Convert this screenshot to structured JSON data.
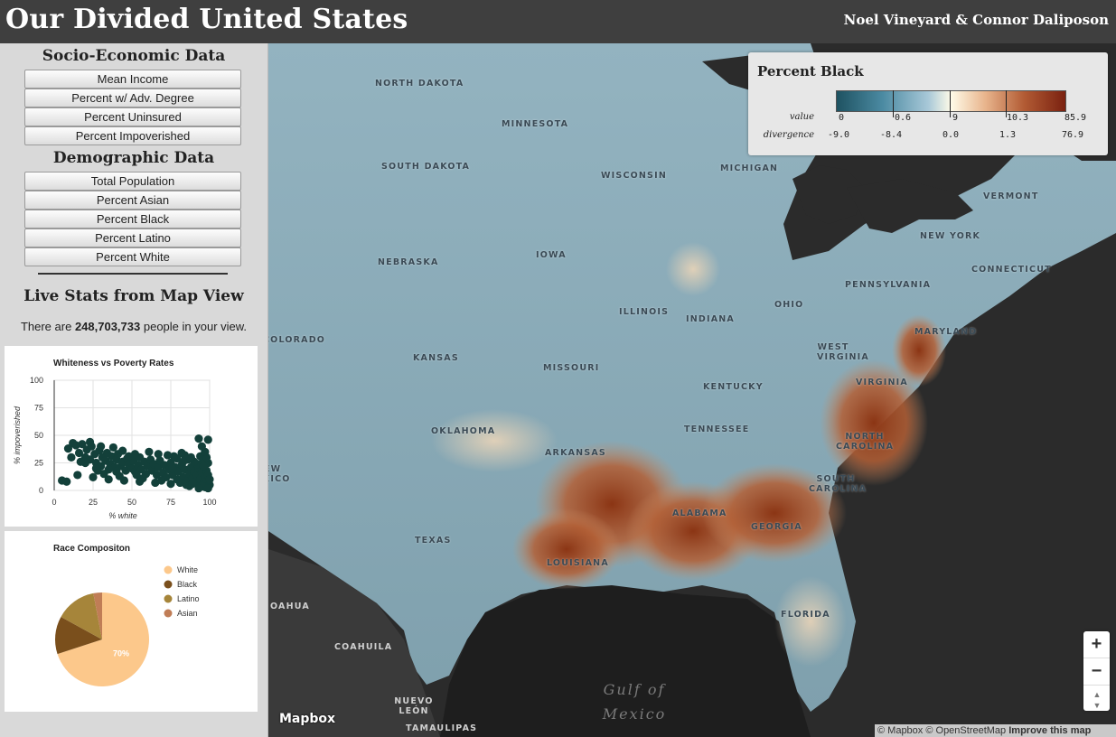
{
  "header": {
    "title": "Our Divided United States",
    "authors": "Noel Vineyard & Connor Daliposon"
  },
  "sidebar": {
    "socio_title": "Socio-Economic Data",
    "socio_buttons": [
      "Mean Income",
      "Percent w/ Adv. Degree",
      "Percent Uninsured",
      "Percent Impoverished"
    ],
    "demo_title": "Demographic Data",
    "demo_buttons": [
      "Total Population",
      "Percent Asian",
      "Percent Black",
      "Percent Latino",
      "Percent White"
    ],
    "live_title": "Live Stats from Map View",
    "people_prefix": "There are",
    "people_count": "248,703,733",
    "people_suffix": "people in your view."
  },
  "chart_data": [
    {
      "type": "scatter",
      "title": "Whiteness vs Poverty Rates",
      "xlabel": "% white",
      "ylabel": "% impoverished",
      "xlim": [
        0,
        100
      ],
      "ylim": [
        0,
        100
      ],
      "xticks": [
        0,
        25,
        50,
        75,
        100
      ],
      "yticks": [
        0,
        25,
        50,
        75,
        100
      ],
      "grid": true,
      "color": "#13403a",
      "points": [
        [
          5,
          9
        ],
        [
          9,
          38
        ],
        [
          12,
          43
        ],
        [
          14,
          41
        ],
        [
          16,
          34
        ],
        [
          18,
          42
        ],
        [
          20,
          30
        ],
        [
          21,
          37
        ],
        [
          23,
          28
        ],
        [
          24,
          40
        ],
        [
          26,
          33
        ],
        [
          27,
          25
        ],
        [
          29,
          36
        ],
        [
          30,
          22
        ],
        [
          31,
          30
        ],
        [
          33,
          27
        ],
        [
          34,
          34
        ],
        [
          36,
          24
        ],
        [
          37,
          31
        ],
        [
          39,
          21
        ],
        [
          40,
          28
        ],
        [
          41,
          33
        ],
        [
          43,
          22
        ],
        [
          44,
          26
        ],
        [
          46,
          18
        ],
        [
          47,
          29
        ],
        [
          48,
          24
        ],
        [
          50,
          20
        ],
        [
          51,
          27
        ],
        [
          52,
          17
        ],
        [
          54,
          23
        ],
        [
          55,
          30
        ],
        [
          56,
          19
        ],
        [
          58,
          26
        ],
        [
          59,
          15
        ],
        [
          60,
          22
        ],
        [
          62,
          28
        ],
        [
          63,
          18
        ],
        [
          64,
          24
        ],
        [
          66,
          14
        ],
        [
          67,
          21
        ],
        [
          68,
          27
        ],
        [
          70,
          16
        ],
        [
          71,
          23
        ],
        [
          72,
          12
        ],
        [
          74,
          19
        ],
        [
          75,
          25
        ],
        [
          76,
          14
        ],
        [
          78,
          21
        ],
        [
          79,
          10
        ],
        [
          80,
          17
        ],
        [
          82,
          23
        ],
        [
          83,
          12
        ],
        [
          84,
          19
        ],
        [
          86,
          9
        ],
        [
          87,
          15
        ],
        [
          88,
          21
        ],
        [
          89,
          11
        ],
        [
          90,
          17
        ],
        [
          91,
          8
        ],
        [
          92,
          14
        ],
        [
          93,
          20
        ],
        [
          94,
          10
        ],
        [
          95,
          16
        ],
        [
          96,
          6
        ],
        [
          97,
          12
        ],
        [
          98,
          18
        ],
        [
          98,
          8
        ],
        [
          99,
          46
        ],
        [
          99,
          14
        ],
        [
          100,
          5
        ],
        [
          100,
          10
        ],
        [
          97,
          3
        ],
        [
          95,
          4
        ],
        [
          85,
          5
        ],
        [
          75,
          6
        ],
        [
          65,
          7
        ],
        [
          55,
          8
        ],
        [
          45,
          9
        ],
        [
          35,
          10
        ],
        [
          25,
          12
        ],
        [
          15,
          14
        ],
        [
          8,
          8
        ],
        [
          96,
          27
        ],
        [
          94,
          31
        ],
        [
          92,
          24
        ],
        [
          90,
          26
        ],
        [
          88,
          30
        ],
        [
          86,
          28
        ],
        [
          84,
          32
        ],
        [
          82,
          34
        ],
        [
          79,
          29
        ],
        [
          77,
          31
        ],
        [
          52,
          33
        ],
        [
          44,
          36
        ],
        [
          38,
          39
        ],
        [
          30,
          40
        ],
        [
          23,
          44
        ],
        [
          20,
          25
        ],
        [
          28,
          18
        ],
        [
          32,
          15
        ],
        [
          42,
          13
        ],
        [
          57,
          11
        ],
        [
          61,
          35
        ],
        [
          69,
          9
        ],
        [
          73,
          32
        ],
        [
          81,
          7
        ],
        [
          87,
          4
        ],
        [
          93,
          2
        ],
        [
          99,
          2
        ],
        [
          99,
          25
        ],
        [
          98,
          30
        ],
        [
          97,
          35
        ],
        [
          95,
          40
        ],
        [
          93,
          47
        ],
        [
          96,
          22
        ],
        [
          89,
          6
        ],
        [
          83,
          26
        ],
        [
          76,
          20
        ],
        [
          67,
          33
        ],
        [
          53,
          14
        ],
        [
          48,
          31
        ],
        [
          40,
          17
        ],
        [
          35,
          19
        ],
        [
          27,
          20
        ],
        [
          17,
          26
        ],
        [
          11,
          30
        ]
      ]
    },
    {
      "type": "pie",
      "title": "Race Compositon",
      "legend": "right",
      "slices": [
        {
          "label": "White",
          "value": 70,
          "color": "#fcc88b",
          "shown_label": "70%"
        },
        {
          "label": "Black",
          "value": 13,
          "color": "#7a4f1c",
          "shown_label": ""
        },
        {
          "label": "Latino",
          "value": 14,
          "color": "#a6853a",
          "shown_label": ""
        },
        {
          "label": "Asian",
          "value": 3,
          "color": "#c07d56",
          "shown_label": ""
        }
      ]
    }
  ],
  "map": {
    "labels": [
      "NORTH DAKOTA",
      "MINNESOTA",
      "SOUTH DAKOTA",
      "WISCONSIN",
      "MICHIGAN",
      "VERMONT",
      "NEW YORK",
      "CONNECTICUT",
      "NEBRASKA",
      "IOWA",
      "PENNSYLVANIA",
      "ILLINOIS",
      "INDIANA",
      "OHIO",
      "MARYLAND",
      "KANSAS",
      "MISSOURI",
      "WEST VIRGINIA",
      "VIRGINIA",
      "KENTUCKY",
      "OKLAHOMA",
      "TENNESSEE",
      "NORTH CAROLINA",
      "ARKANSAS",
      "SOUTH CAROLINA",
      "ALABAMA",
      "GEORGIA",
      "TEXAS",
      "LOUISIANA",
      "FLORIDA",
      "COLORADO",
      "NEW MEXICO",
      "COAHUILA",
      "NUEVO LEÓN",
      "TAMAULIPAS",
      "OAHUA"
    ],
    "gulf_label": "Gulf of Mexico",
    "logo": "Mapbox",
    "attribution": "© Mapbox © OpenStreetMap",
    "improve_link": "Improve this map",
    "zoom_in": "+",
    "zoom_out": "−",
    "compass": "▲▼"
  },
  "legend": {
    "title": "Percent Black",
    "value_label": "value",
    "divergence_label": "divergence",
    "values": [
      "0",
      "0.6",
      "9",
      "10.3",
      "85.9"
    ],
    "divergences": [
      "-9.0",
      "-8.4",
      "0.0",
      "1.3",
      "76.9"
    ],
    "gradient_colors": [
      "#1e5261",
      "#4b8aa2",
      "#a8c8d8",
      "#fffbe8",
      "#e8b48c",
      "#b25b34",
      "#7a2110"
    ]
  }
}
